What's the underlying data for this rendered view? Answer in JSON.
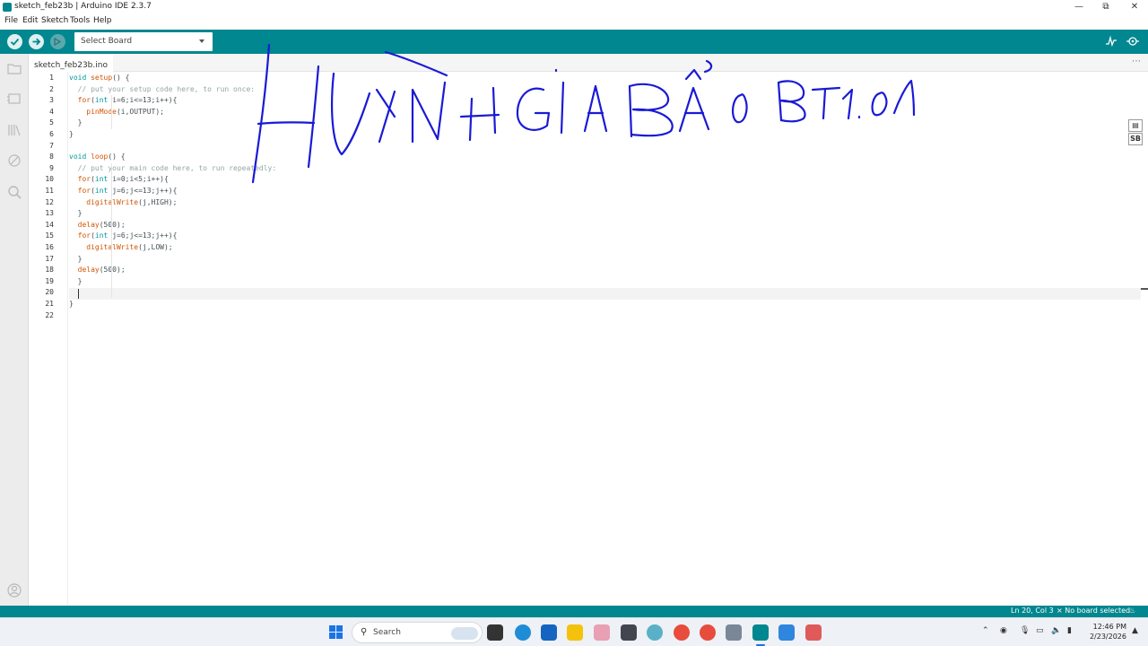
{
  "window": {
    "title": "sketch_feb23b | Arduino IDE 2.3.7"
  },
  "menubar": {
    "items": [
      "File",
      "Edit",
      "Sketch",
      "Tools",
      "Help"
    ]
  },
  "toolbar": {
    "board_select": "Select Board"
  },
  "tabs": {
    "active_file": "sketch_feb23b.ino",
    "menu": "⋯"
  },
  "editor": {
    "line_numbers": [
      "1",
      "2",
      "3",
      "4",
      "5",
      "6",
      "7",
      "8",
      "9",
      "10",
      "11",
      "12",
      "13",
      "14",
      "15",
      "16",
      "17",
      "18",
      "19",
      "20",
      "21",
      "22"
    ],
    "lines": [
      "void setup() {",
      "  // put your setup code here, to run once:",
      "  for(int i=6;i<=13;i++){",
      "    pinMode(i,OUTPUT);",
      "  }",
      "}",
      "",
      "void loop() {",
      "  // put your main code here, to run repeatedly:",
      "  for(int i=0;i<5;i++){",
      "  for(int j=6;j<=13;j++){",
      "    digitalWrite(j,HIGH);",
      "  }",
      "  delay(500);",
      "  for(int j=6;j<=13;j++){",
      "    digitalWrite(j,LOW);",
      "  }",
      "  delay(500);",
      "  }",
      "  ",
      "}",
      ""
    ],
    "current_line": 20,
    "handwriting": "HUỲNH GIA BẢO BT1.01"
  },
  "side_panel": {
    "badge": "SB"
  },
  "status": {
    "position": "Ln 20, Col 3",
    "board": "No board selected",
    "close": "×"
  },
  "taskbar": {
    "search_placeholder": "Search",
    "clock_time": "12:46 PM",
    "clock_date": "2/23/2026",
    "colors": {
      "accent": "#00878f",
      "brand": "#1a73e8"
    }
  }
}
